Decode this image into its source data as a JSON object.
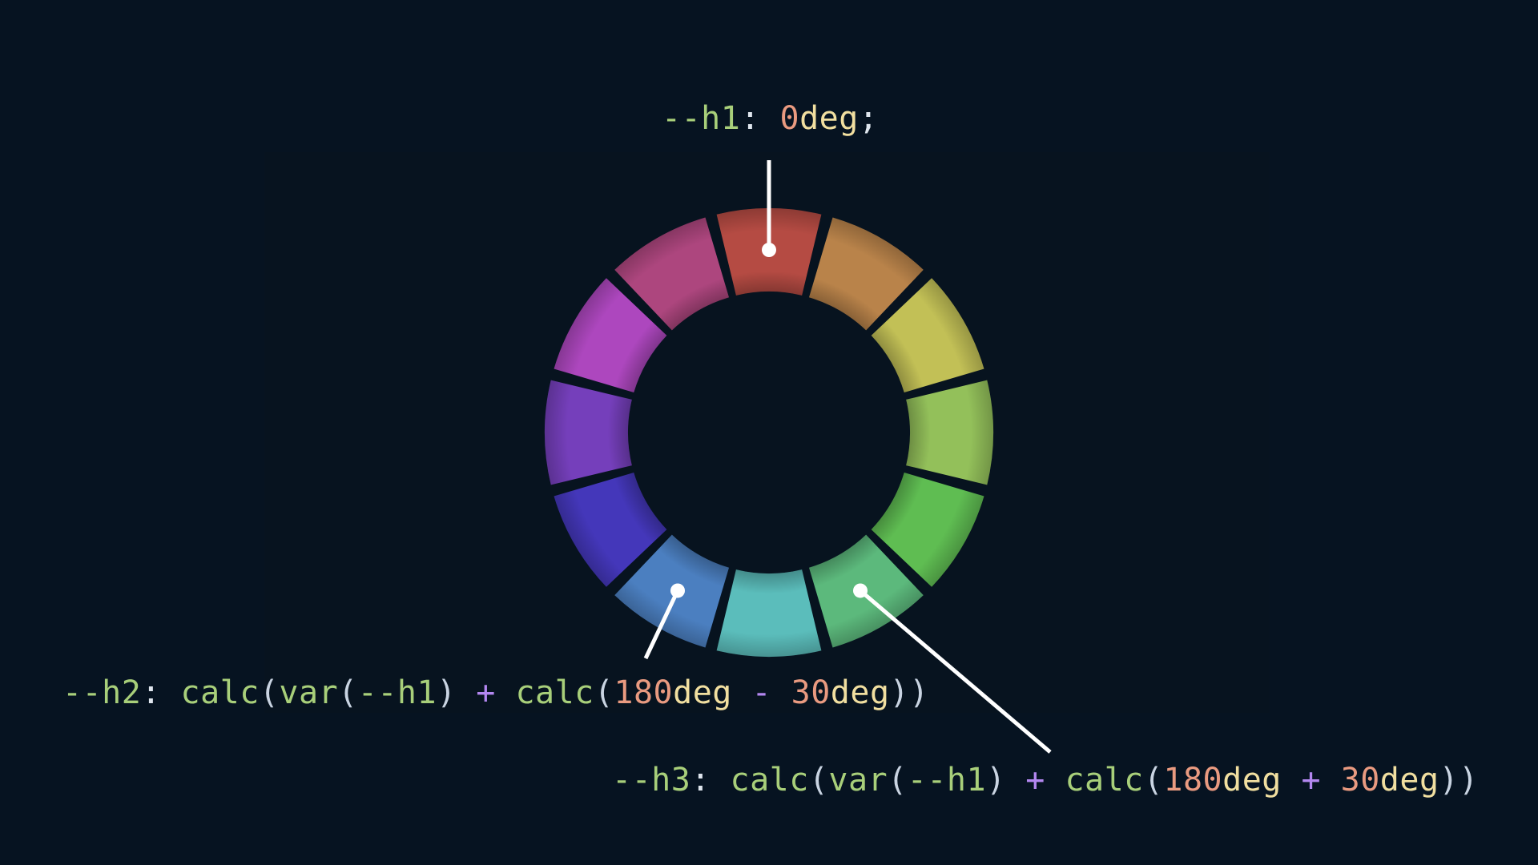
{
  "wheel": {
    "segment_count": 12,
    "segments": [
      {
        "hue_deg": 0,
        "color": "#b54b43"
      },
      {
        "hue_deg": 30,
        "color": "#b9834a"
      },
      {
        "hue_deg": 60,
        "color": "#c2c056"
      },
      {
        "hue_deg": 90,
        "color": "#93c05a"
      },
      {
        "hue_deg": 120,
        "color": "#5fbd52"
      },
      {
        "hue_deg": 150,
        "color": "#5cb97c"
      },
      {
        "hue_deg": 180,
        "color": "#5bbdbb"
      },
      {
        "hue_deg": 210,
        "color": "#4b7fc0"
      },
      {
        "hue_deg": 240,
        "color": "#4437ba"
      },
      {
        "hue_deg": 270,
        "color": "#753fbb"
      },
      {
        "hue_deg": 300,
        "color": "#ad47be"
      },
      {
        "hue_deg": 330,
        "color": "#ad467e"
      }
    ],
    "markers": [
      {
        "name": "h1",
        "hue_deg": 0
      },
      {
        "name": "h2",
        "hue_deg": 210
      },
      {
        "name": "h3",
        "hue_deg": 150
      }
    ]
  },
  "colors": {
    "background": "#061321",
    "variable": "#a8cf7a",
    "number": "#e99a80",
    "unit": "#f1dfa0",
    "operator": "#b387f0",
    "leader_line": "#ffffff"
  },
  "labels": {
    "h1": {
      "var": "--h1",
      "colon": ": ",
      "num": "0",
      "unit": "deg",
      "end": ";"
    },
    "h2": {
      "var": "--h2",
      "colon": ": ",
      "fn1": "calc",
      "p1": "(",
      "fn2": "var",
      "p2": "(",
      "ref": "--h1",
      "p3": ")",
      "op1": " + ",
      "fn3": "calc",
      "p4": "(",
      "num1": "180",
      "unit1": "deg",
      "op2": " - ",
      "num2": "30",
      "unit2": "deg",
      "p5": "))"
    },
    "h3": {
      "var": "--h3",
      "colon": ": ",
      "fn1": "calc",
      "p1": "(",
      "fn2": "var",
      "p2": "(",
      "ref": "--h1",
      "p3": ")",
      "op1": " + ",
      "fn3": "calc",
      "p4": "(",
      "num1": "180",
      "unit1": "deg",
      "op2": " + ",
      "num2": "30",
      "unit2": "deg",
      "p5": "))"
    }
  }
}
